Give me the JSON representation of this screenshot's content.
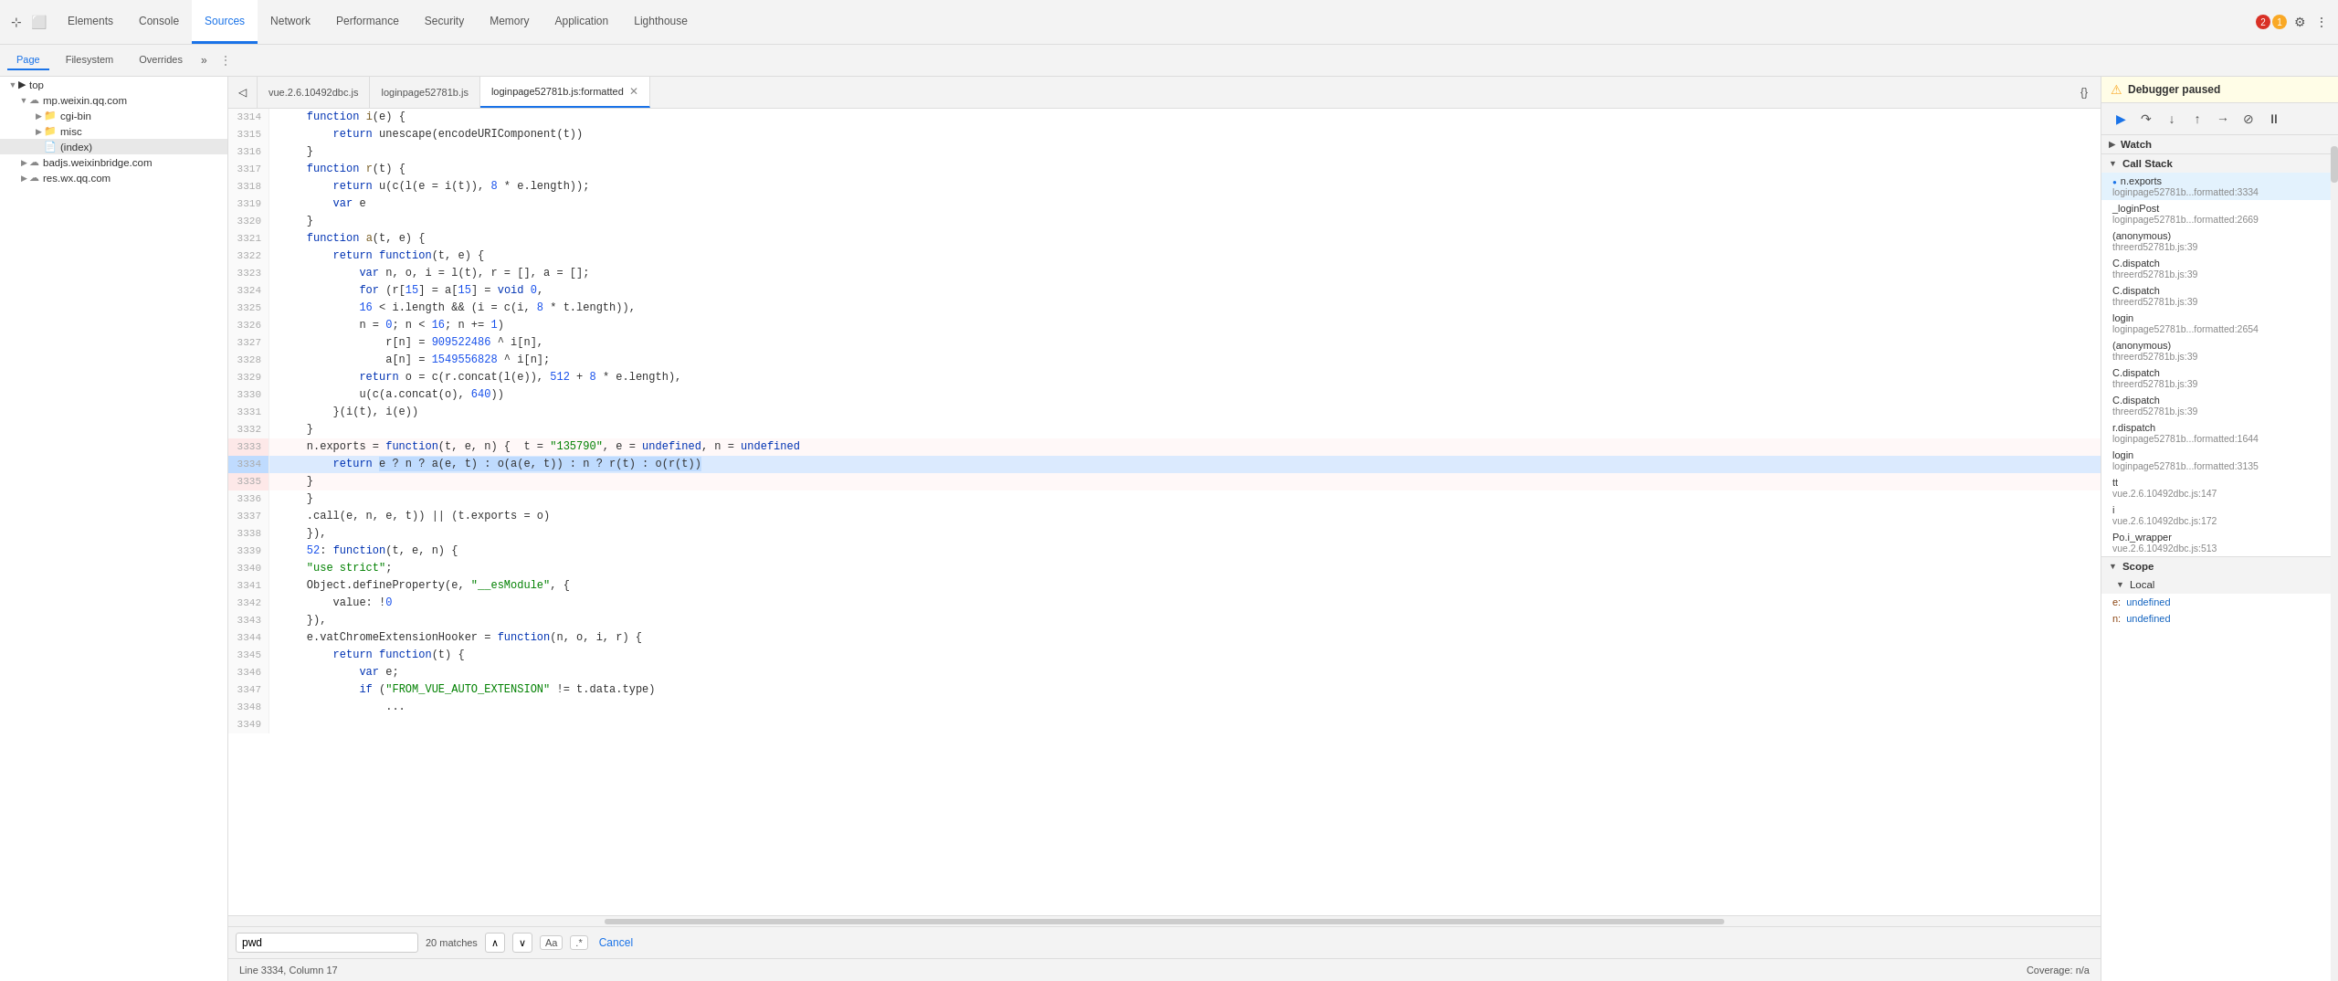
{
  "toolbar": {
    "icons": [
      "cursor",
      "box"
    ],
    "tabs": [
      {
        "label": "Elements",
        "active": false
      },
      {
        "label": "Console",
        "active": false
      },
      {
        "label": "Sources",
        "active": true
      },
      {
        "label": "Network",
        "active": false
      },
      {
        "label": "Performance",
        "active": false
      },
      {
        "label": "Security",
        "active": false
      },
      {
        "label": "Memory",
        "active": false
      },
      {
        "label": "Application",
        "active": false
      },
      {
        "label": "Lighthouse",
        "active": false
      }
    ],
    "error_count": "2",
    "warning_count": "1"
  },
  "sub_toolbar": {
    "tabs": [
      {
        "label": "Page",
        "active": true
      },
      {
        "label": "Filesystem",
        "active": false
      },
      {
        "label": "Overrides",
        "active": false
      }
    ]
  },
  "file_tabs": [
    {
      "label": "vue.2.6.10492dbc.js",
      "active": false,
      "closeable": false
    },
    {
      "label": "loginpage52781b.js",
      "active": false,
      "closeable": false
    },
    {
      "label": "loginpage52781b.js:formatted",
      "active": true,
      "closeable": true
    }
  ],
  "file_tree": {
    "items": [
      {
        "indent": 0,
        "type": "arrow-down",
        "icon": "▶",
        "label": "top",
        "selected": false
      },
      {
        "indent": 1,
        "type": "arrow-down",
        "icon": "☁",
        "label": "mp.weixin.qq.com",
        "selected": false
      },
      {
        "indent": 2,
        "type": "arrow-right",
        "icon": "📁",
        "label": "cgi-bin",
        "selected": false
      },
      {
        "indent": 2,
        "type": "arrow-right",
        "icon": "📁",
        "label": "misc",
        "selected": false
      },
      {
        "indent": 2,
        "type": "none",
        "icon": "📄",
        "label": "(index)",
        "selected": true
      },
      {
        "indent": 1,
        "type": "arrow-right",
        "icon": "☁",
        "label": "badjs.weixinbridge.com",
        "selected": false
      },
      {
        "indent": 1,
        "type": "arrow-right",
        "icon": "☁",
        "label": "res.wx.qq.com",
        "selected": false
      }
    ]
  },
  "code_lines": [
    {
      "num": "3314",
      "content": "    function i(e) {",
      "state": "normal"
    },
    {
      "num": "3315",
      "content": "        return unescape(encodeURIComponent(t))",
      "state": "normal"
    },
    {
      "num": "3316",
      "content": "    }",
      "state": "normal"
    },
    {
      "num": "3317",
      "content": "    function r(t) {",
      "state": "normal"
    },
    {
      "num": "3318",
      "content": "        return u(c(l(e = i(t)), 8 * e.length));",
      "state": "normal"
    },
    {
      "num": "3319",
      "content": "        var e",
      "state": "normal"
    },
    {
      "num": "3320",
      "content": "    }",
      "state": "normal"
    },
    {
      "num": "3321",
      "content": "    function a(t, e) {",
      "state": "normal"
    },
    {
      "num": "3322",
      "content": "        return function(t, e) {",
      "state": "normal"
    },
    {
      "num": "3323",
      "content": "            var n, o, i = l(t), r = [], a = [];",
      "state": "normal"
    },
    {
      "num": "3324",
      "content": "            for (r[15] = a[15] = void 0,",
      "state": "normal"
    },
    {
      "num": "3325",
      "content": "            16 < i.length && (i = c(i, 8 * t.length)),",
      "state": "normal"
    },
    {
      "num": "3326",
      "content": "            n = 0; n < 16; n += 1)",
      "state": "normal"
    },
    {
      "num": "3327",
      "content": "                r[n] = 909522486 ^ i[n],",
      "state": "normal"
    },
    {
      "num": "3328",
      "content": "                a[n] = 1549556828 ^ i[n];",
      "state": "normal"
    },
    {
      "num": "3329",
      "content": "            return o = c(r.concat(l(e)), 512 + 8 * e.length),",
      "state": "normal"
    },
    {
      "num": "3330",
      "content": "            u(c(a.concat(o), 640))",
      "state": "normal"
    },
    {
      "num": "3331",
      "content": "        }(i(t), i(e))",
      "state": "normal"
    },
    {
      "num": "3332",
      "content": "    }",
      "state": "normal"
    },
    {
      "num": "3333",
      "content": "    n.exports = function(t, e, n) {  t = \"135790\", e = undefined, n = undefined",
      "state": "red-top"
    },
    {
      "num": "3334",
      "content": "        return e ? n ? a(e, t) : o(a(e, t)) : n ? r(t) : o(r(t))",
      "state": "red-mid-debug"
    },
    {
      "num": "3335",
      "content": "    }",
      "state": "red-bot"
    },
    {
      "num": "3336",
      "content": "    }",
      "state": "normal"
    },
    {
      "num": "3337",
      "content": "    .call(e, n, e, t)) || (t.exports = o)",
      "state": "normal"
    },
    {
      "num": "3338",
      "content": "    }),",
      "state": "normal"
    },
    {
      "num": "3339",
      "content": "    52: function(t, e, n) {",
      "state": "normal"
    },
    {
      "num": "3340",
      "content": "    \"use strict\";",
      "state": "normal"
    },
    {
      "num": "3341",
      "content": "    Object.defineProperty(e, \"__esModule\", {",
      "state": "normal"
    },
    {
      "num": "3342",
      "content": "        value: !0",
      "state": "normal"
    },
    {
      "num": "3343",
      "content": "    }),",
      "state": "normal"
    },
    {
      "num": "3344",
      "content": "    e.vatChromeExtensionHooker = function(n, o, i, r) {",
      "state": "normal"
    },
    {
      "num": "3345",
      "content": "        return function(t) {",
      "state": "normal"
    },
    {
      "num": "3346",
      "content": "            var e;",
      "state": "normal"
    },
    {
      "num": "3347",
      "content": "            if (\"FROM_VUE_AUTO_EXTENSION\" != t.data.type)",
      "state": "normal"
    },
    {
      "num": "3348",
      "content": "                ...",
      "state": "normal"
    },
    {
      "num": "3349",
      "content": "",
      "state": "normal"
    }
  ],
  "search": {
    "query": "pwd",
    "matches": "20 matches",
    "match_case": "Aa",
    "regex": ".*",
    "cancel": "Cancel"
  },
  "status_bar": {
    "left": "Line 3334, Column 17",
    "right": "Coverage: n/a"
  },
  "right_panel": {
    "debugger_paused": "Debugger paused",
    "debug_buttons": [
      "resume",
      "step-over",
      "step-into",
      "step-out",
      "step",
      "deactivate",
      "pause"
    ],
    "watch_label": "Watch",
    "call_stack_label": "Call Stack",
    "call_stack_items": [
      {
        "func": "n.exports",
        "file": "loginpage52781b...formatted:3334",
        "active": true
      },
      {
        "func": "_loginPost",
        "file": "loginpage52781b...formatted:2669",
        "active": false
      },
      {
        "func": "(anonymous)",
        "file": "threerd52781b.js:39",
        "active": false
      },
      {
        "func": "C.dispatch",
        "file": "threerd52781b.js:39",
        "active": false
      },
      {
        "func": "C.dispatch",
        "file": "threerd52781b.js:39",
        "active": false
      },
      {
        "func": "login",
        "file": "loginpage52781b...formatted:2654",
        "active": false
      },
      {
        "func": "(anonymous)",
        "file": "threerd52781b.js:39",
        "active": false
      },
      {
        "func": "C.dispatch",
        "file": "threerd52781b.js:39",
        "active": false
      },
      {
        "func": "C.dispatch",
        "file": "threerd52781b.js:39",
        "active": false
      },
      {
        "func": "r.dispatch",
        "file": "loginpage52781b...formatted:1644",
        "active": false
      },
      {
        "func": "login",
        "file": "loginpage52781b...formatted:3135",
        "active": false
      },
      {
        "func": "tt",
        "file": "vue.2.6.10492dbc.js:147",
        "active": false
      },
      {
        "func": "i",
        "file": "vue.2.6.10492dbc.js:172",
        "active": false
      },
      {
        "func": "Po.i_wrapper",
        "file": "vue.2.6.10492dbc.js:513",
        "active": false
      }
    ],
    "scope_label": "Scope",
    "scope_local_label": "Local",
    "scope_vars": [
      {
        "key": "e:",
        "val": "undefined"
      },
      {
        "key": "n:",
        "val": "undefined"
      }
    ]
  }
}
